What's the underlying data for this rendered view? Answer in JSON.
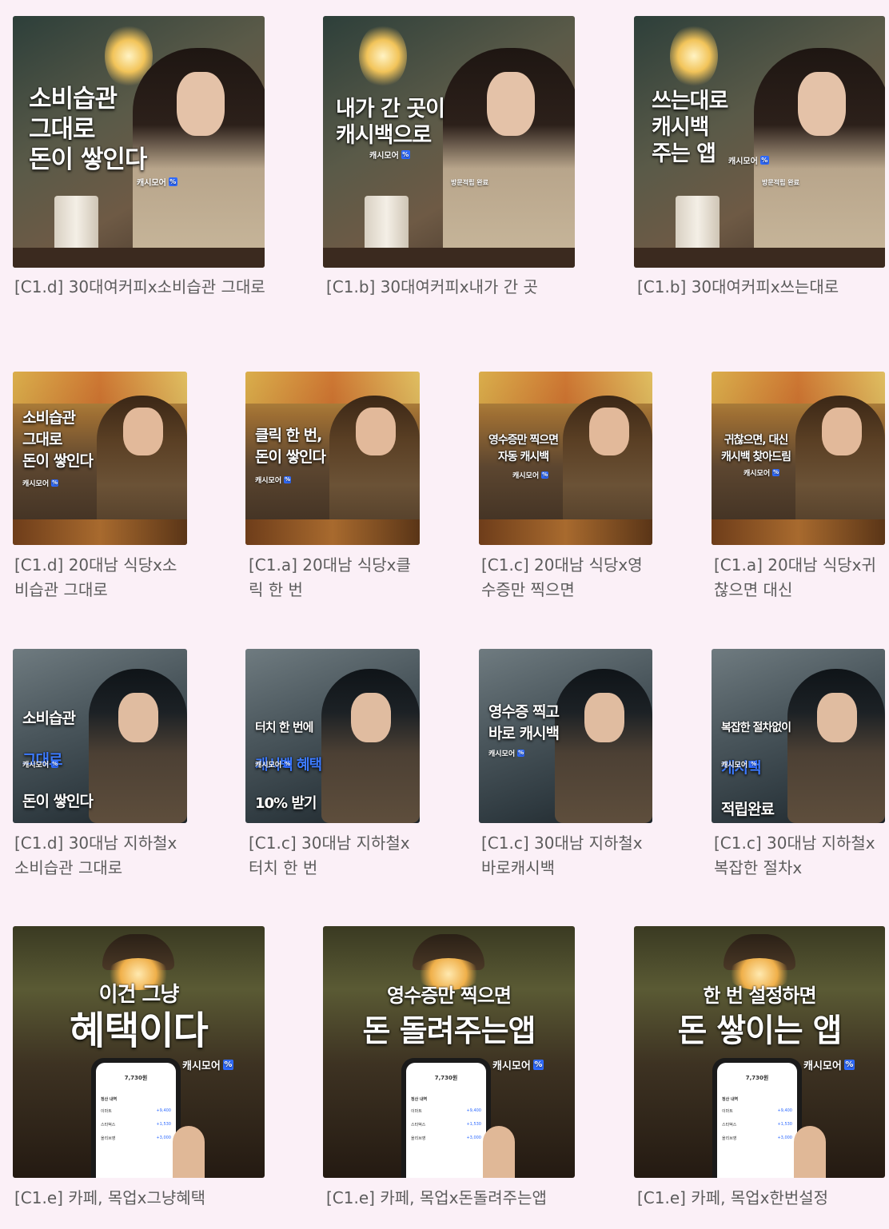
{
  "brand": {
    "name": "캐시모어",
    "logo_glyph": "%",
    "accent_color": "#2f6bff",
    "background": "#fbf0f7"
  },
  "rows": [
    {
      "cards": [
        {
          "caption": "[C1.d] 30대여커피x소비습관 그대로",
          "headline": "소비습관\n그대로\n돈이 쌓인다",
          "accent": ""
        },
        {
          "caption": "[C1.b] 30대여커피x내가 간 곳",
          "headline": "내가 간 곳이\n캐시백으로",
          "accent": ""
        },
        {
          "caption": "[C1.b] 30대여커피x쓰는대로",
          "headline": "쓰는대로\n캐시백\n주는 앱",
          "accent": ""
        }
      ]
    },
    {
      "cards": [
        {
          "caption": "[C1.d] 20대남 식당x소비습관 그대로",
          "headline": "소비습관\n그대로\n돈이 쌓인다",
          "accent": ""
        },
        {
          "caption": "[C1.a] 20대남 식당x클릭 한 번",
          "headline": "클릭 한 번,\n돈이 쌓인다",
          "accent": ""
        },
        {
          "caption": "[C1.c] 20대남 식당x영수증만 찍으면",
          "headline": "영수증만 찍으면\n자동 캐시백",
          "accent": ""
        },
        {
          "caption": "[C1.a] 20대남 식당x귀찮으면 대신",
          "headline": "귀찮으면, 대신\n캐시백 찾아드림",
          "accent": ""
        }
      ]
    },
    {
      "cards": [
        {
          "caption": "[C1.d] 30대남 지하철x소비습관 그대로",
          "headline_pre": "소비습관",
          "headline_accent": "그대로",
          "headline_post": "돈이 쌓인다"
        },
        {
          "caption": "[C1.c] 30대남 지하철x터치 한 번",
          "headline_pre": "터치 한 번에",
          "headline_accent": "캐시백 혜택",
          "headline_post": "10% 받기"
        },
        {
          "caption": "[C1.c] 30대남 지하철x바로캐시백",
          "headline_pre": "영수증 찍고\n바로 캐시백",
          "headline_accent": "",
          "headline_post": ""
        },
        {
          "caption": "[C1.c] 30대남 지하철x복잡한 절차x",
          "headline_pre": "복잡한 절차없이",
          "headline_accent": "캐시백",
          "headline_post": "적립완료"
        }
      ]
    },
    {
      "cards": [
        {
          "caption": "[C1.e] 카페, 목업x그냥혜택",
          "headline_small": "이건 그냥",
          "headline_big": "혜택이다"
        },
        {
          "caption": "[C1.e] 카페, 목업x돈돌려주는앱",
          "headline_small": "영수증만 찍으면",
          "headline_big": "돈 돌려주는앱"
        },
        {
          "caption": "[C1.e] 카페, 목업x한번설정",
          "headline_small": "한 번 설정하면",
          "headline_big": "돈 쌓이는 앱"
        }
      ]
    }
  ],
  "phone_screen": {
    "amount": "7,730원",
    "list_title": "정산 내역",
    "items": [
      {
        "name": "이마트",
        "value": "+9,400"
      },
      {
        "name": "스타벅스",
        "value": "+1,530"
      },
      {
        "name": "올리브영",
        "value": "+3,000"
      }
    ]
  },
  "badge_small": "방문적립 완료"
}
